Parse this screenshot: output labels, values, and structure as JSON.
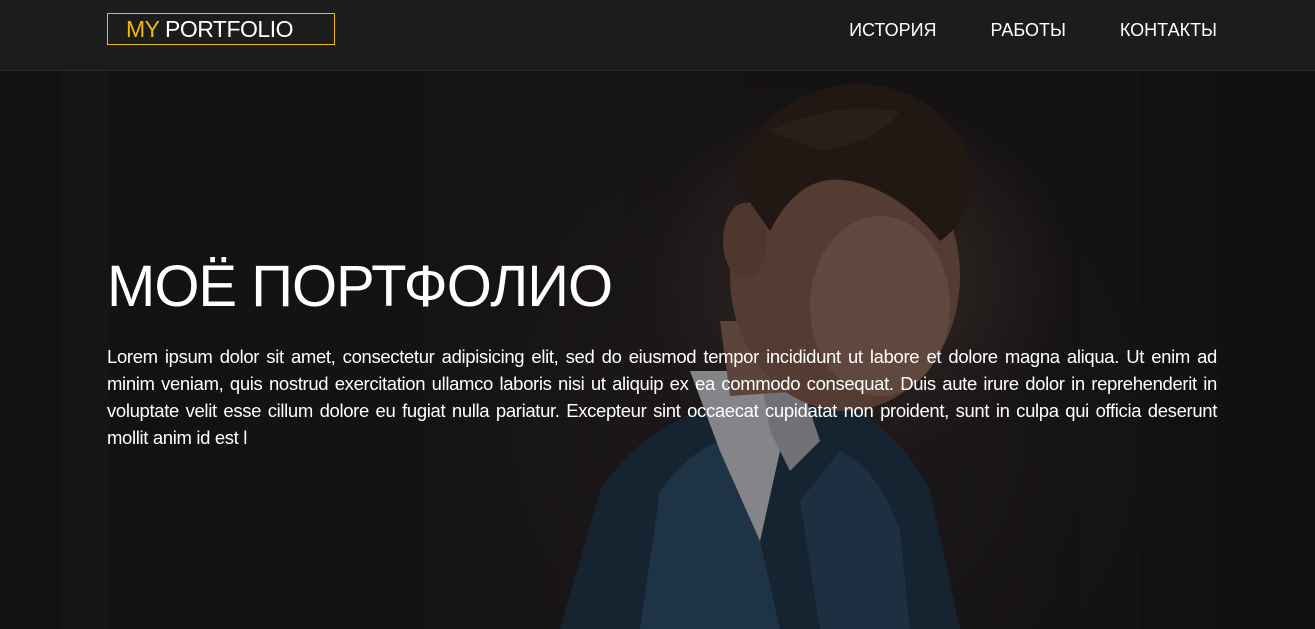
{
  "header": {
    "logo": {
      "accent": "MY",
      "rest": " PORTFOLIO"
    },
    "nav": [
      {
        "label": "ИСТОРИЯ"
      },
      {
        "label": "РАБОТЫ"
      },
      {
        "label": "КОНТАКТЫ"
      }
    ]
  },
  "hero": {
    "title": "МОЁ ПОРТФОЛИО",
    "text": "Lorem ipsum dolor sit amet, consectetur adipisicing elit, sed do eiusmod tempor incididunt ut labore et dolore magna aliqua. Ut enim ad minim veniam, quis nostrud exercitation ullamco laboris nisi ut aliquip ex ea commodo consequat. Duis aute irure dolor in reprehenderit in voluptate velit esse cillum dolore eu fugiat nulla pariatur. Excepteur sint occaecat cupidatat non proident, sunt in culpa qui officia deserunt mollit anim id est l"
  },
  "colors": {
    "accent": "#f0b90b",
    "header_bg": "#1b1d1c",
    "text": "#ffffff"
  }
}
